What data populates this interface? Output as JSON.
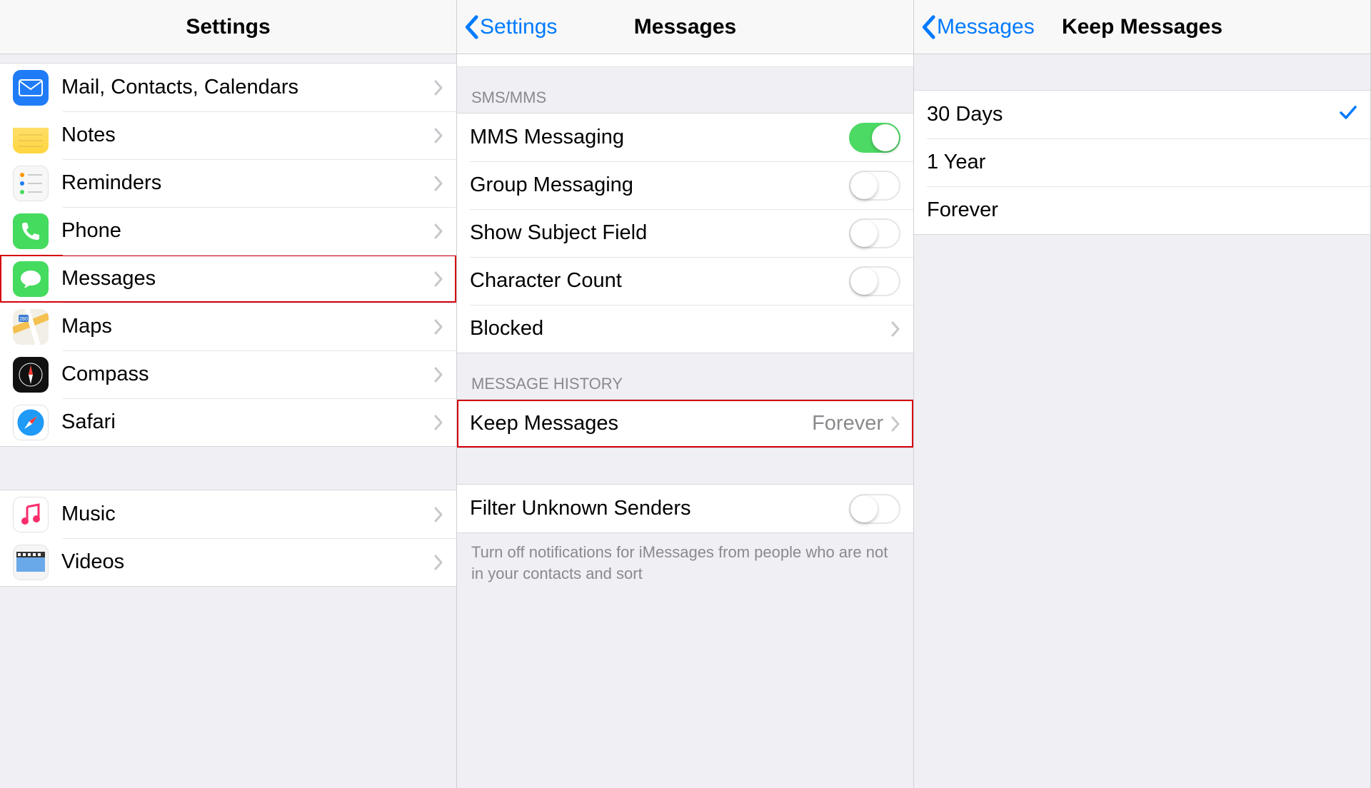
{
  "panel1": {
    "title": "Settings",
    "group1": [
      {
        "key": "mail",
        "label": "Mail, Contacts, Calendars"
      },
      {
        "key": "notes",
        "label": "Notes"
      },
      {
        "key": "reminders",
        "label": "Reminders"
      },
      {
        "key": "phone",
        "label": "Phone"
      },
      {
        "key": "messages",
        "label": "Messages"
      },
      {
        "key": "maps",
        "label": "Maps"
      },
      {
        "key": "compass",
        "label": "Compass"
      },
      {
        "key": "safari",
        "label": "Safari"
      }
    ],
    "group2": [
      {
        "key": "music",
        "label": "Music"
      },
      {
        "key": "videos",
        "label": "Videos"
      }
    ],
    "highlight": "messages"
  },
  "panel2": {
    "back": "Settings",
    "title": "Messages",
    "section1_header": "SMS/MMS",
    "sms": [
      {
        "key": "mms",
        "label": "MMS Messaging",
        "type": "toggle",
        "on": true
      },
      {
        "key": "group",
        "label": "Group Messaging",
        "type": "toggle",
        "on": false
      },
      {
        "key": "subject",
        "label": "Show Subject Field",
        "type": "toggle",
        "on": false
      },
      {
        "key": "charcount",
        "label": "Character Count",
        "type": "toggle",
        "on": false
      },
      {
        "key": "blocked",
        "label": "Blocked",
        "type": "link"
      }
    ],
    "section2_header": "MESSAGE HISTORY",
    "keep_label": "Keep Messages",
    "keep_value": "Forever",
    "filter_label": "Filter Unknown Senders",
    "filter_on": false,
    "footer": "Turn off notifications for iMessages from people who are not in your contacts and sort"
  },
  "panel3": {
    "back": "Messages",
    "title": "Keep Messages",
    "options": [
      {
        "key": "30d",
        "label": "30 Days",
        "selected": true
      },
      {
        "key": "1y",
        "label": "1 Year",
        "selected": false
      },
      {
        "key": "forever",
        "label": "Forever",
        "selected": false
      }
    ]
  }
}
